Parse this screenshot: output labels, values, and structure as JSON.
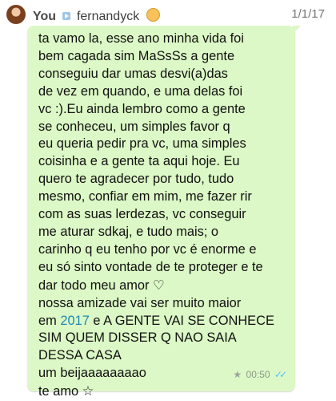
{
  "header": {
    "sender": "You",
    "recipient": "fernandyck",
    "date": "1/1/17"
  },
  "message": {
    "lines": [
      "ta vamo la, esse ano minha vida foi",
      "bem cagada sim MaSsSs a gente",
      "conseguiu dar umas desvi(a)das",
      "de vez em quando, e uma delas foi",
      "vc :).Eu ainda lembro como a gente",
      "se conheceu, um simples favor q",
      "eu queria pedir pra vc, uma simples",
      "coisinha e a gente ta aqui hoje. Eu",
      "quero te agradecer por tudo, tudo",
      "mesmo, confiar em mim, me fazer rir",
      "com as suas lerdezas, vc conseguir",
      "me aturar sdkaj, e tudo mais; o",
      "carinho q eu tenho por vc é enorme e",
      "eu só sinto vontade de te proteger e te",
      "dar todo meu amor",
      "nossa amizade vai ser muito maior",
      "em",
      "2017",
      "e A GENTE VAI SE CONHECE",
      "SIM QUEM DISSER Q NAO SAIA",
      "DESSA CASA",
      "um beijaaaaaaaao",
      "te amo"
    ],
    "heart": "♡",
    "star": "☆",
    "time": "00:50",
    "ticks": "✓✓",
    "starred_icon": "★"
  },
  "icons": {
    "avatar": "avatar",
    "forward": "forward-icon",
    "emoji": "baby-emoji-icon",
    "starred": "star-icon",
    "read_receipt": "double-check-icon"
  },
  "colors": {
    "bubble": "#dcf8c6",
    "link": "#1d8ab6",
    "ticks": "#4fc3f7"
  }
}
